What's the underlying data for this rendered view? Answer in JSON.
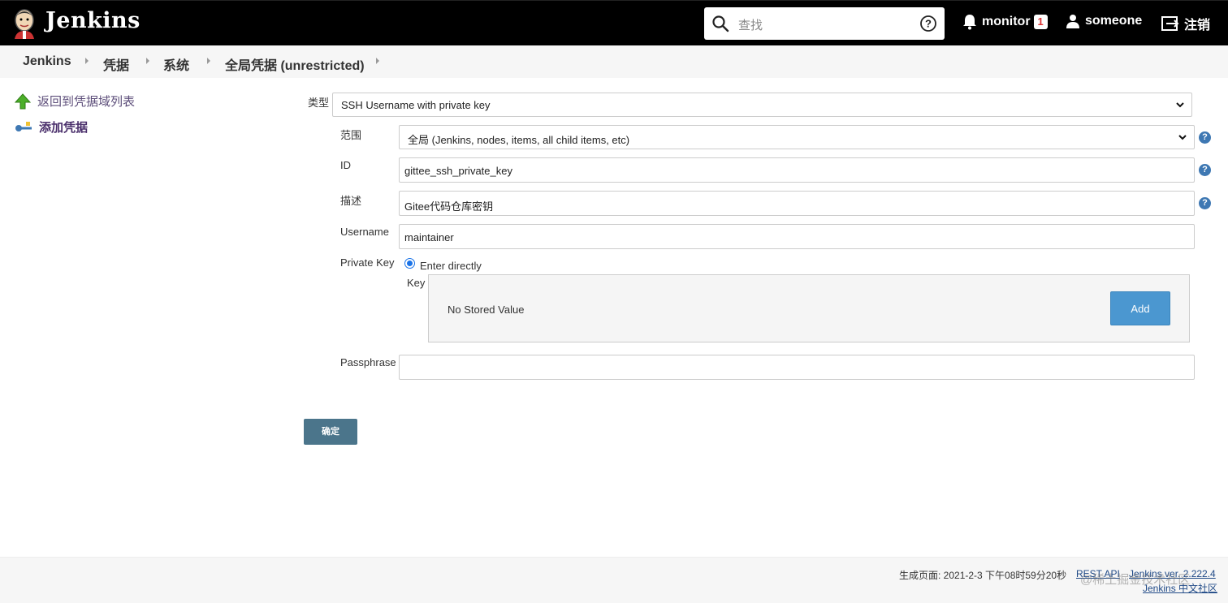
{
  "header": {
    "title": "Jenkins",
    "search_placeholder": "查找",
    "notifications_user": "monitor",
    "notifications_count": "1",
    "user": "someone",
    "logout": "注销"
  },
  "breadcrumbs": [
    "Jenkins",
    "凭据",
    "系统",
    "全局凭据 (unrestricted)"
  ],
  "sidebar": {
    "items": [
      {
        "label": "返回到凭据域列表",
        "icon": "up-arrow-icon"
      },
      {
        "label": "添加凭据",
        "icon": "key-icon"
      }
    ]
  },
  "form": {
    "kind_label": "类型",
    "kind_value": "SSH Username with private key",
    "scope_label": "范围",
    "scope_value": "全局 (Jenkins, nodes, items, all child items, etc)",
    "id_label": "ID",
    "id_value": "gittee_ssh_private_key",
    "description_label": "描述",
    "description_value": "Gitee代码仓库密钥",
    "username_label": "Username",
    "username_value": "maintainer",
    "private_key_label": "Private Key",
    "private_key_option": "Enter directly",
    "key_label": "Key",
    "key_status": "No Stored Value",
    "add_label": "Add",
    "passphrase_label": "Passphrase",
    "passphrase_value": "",
    "submit_label": "确定"
  },
  "footer": {
    "generated": "生成页面: 2021-2-3 下午08时59分20秒",
    "rest_api": "REST API",
    "version": "Jenkins ver. 2.222.4",
    "community": "Jenkins 中文社区",
    "watermark": "@稀土掘金技术社区"
  },
  "colors": {
    "header_bg": "#000000",
    "primary_button": "#4b758b",
    "add_button": "#4b97d0",
    "help_icon": "#3e78b3"
  }
}
